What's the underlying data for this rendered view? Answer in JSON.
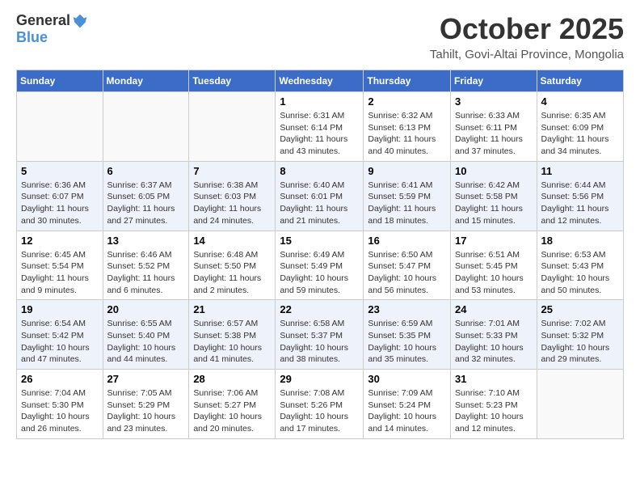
{
  "header": {
    "logo_general": "General",
    "logo_blue": "Blue",
    "month_title": "October 2025",
    "location": "Tahilt, Govi-Altai Province, Mongolia"
  },
  "weekdays": [
    "Sunday",
    "Monday",
    "Tuesday",
    "Wednesday",
    "Thursday",
    "Friday",
    "Saturday"
  ],
  "weeks": [
    [
      {
        "day": "",
        "info": ""
      },
      {
        "day": "",
        "info": ""
      },
      {
        "day": "",
        "info": ""
      },
      {
        "day": "1",
        "info": "Sunrise: 6:31 AM\nSunset: 6:14 PM\nDaylight: 11 hours and 43 minutes."
      },
      {
        "day": "2",
        "info": "Sunrise: 6:32 AM\nSunset: 6:13 PM\nDaylight: 11 hours and 40 minutes."
      },
      {
        "day": "3",
        "info": "Sunrise: 6:33 AM\nSunset: 6:11 PM\nDaylight: 11 hours and 37 minutes."
      },
      {
        "day": "4",
        "info": "Sunrise: 6:35 AM\nSunset: 6:09 PM\nDaylight: 11 hours and 34 minutes."
      }
    ],
    [
      {
        "day": "5",
        "info": "Sunrise: 6:36 AM\nSunset: 6:07 PM\nDaylight: 11 hours and 30 minutes."
      },
      {
        "day": "6",
        "info": "Sunrise: 6:37 AM\nSunset: 6:05 PM\nDaylight: 11 hours and 27 minutes."
      },
      {
        "day": "7",
        "info": "Sunrise: 6:38 AM\nSunset: 6:03 PM\nDaylight: 11 hours and 24 minutes."
      },
      {
        "day": "8",
        "info": "Sunrise: 6:40 AM\nSunset: 6:01 PM\nDaylight: 11 hours and 21 minutes."
      },
      {
        "day": "9",
        "info": "Sunrise: 6:41 AM\nSunset: 5:59 PM\nDaylight: 11 hours and 18 minutes."
      },
      {
        "day": "10",
        "info": "Sunrise: 6:42 AM\nSunset: 5:58 PM\nDaylight: 11 hours and 15 minutes."
      },
      {
        "day": "11",
        "info": "Sunrise: 6:44 AM\nSunset: 5:56 PM\nDaylight: 11 hours and 12 minutes."
      }
    ],
    [
      {
        "day": "12",
        "info": "Sunrise: 6:45 AM\nSunset: 5:54 PM\nDaylight: 11 hours and 9 minutes."
      },
      {
        "day": "13",
        "info": "Sunrise: 6:46 AM\nSunset: 5:52 PM\nDaylight: 11 hours and 6 minutes."
      },
      {
        "day": "14",
        "info": "Sunrise: 6:48 AM\nSunset: 5:50 PM\nDaylight: 11 hours and 2 minutes."
      },
      {
        "day": "15",
        "info": "Sunrise: 6:49 AM\nSunset: 5:49 PM\nDaylight: 10 hours and 59 minutes."
      },
      {
        "day": "16",
        "info": "Sunrise: 6:50 AM\nSunset: 5:47 PM\nDaylight: 10 hours and 56 minutes."
      },
      {
        "day": "17",
        "info": "Sunrise: 6:51 AM\nSunset: 5:45 PM\nDaylight: 10 hours and 53 minutes."
      },
      {
        "day": "18",
        "info": "Sunrise: 6:53 AM\nSunset: 5:43 PM\nDaylight: 10 hours and 50 minutes."
      }
    ],
    [
      {
        "day": "19",
        "info": "Sunrise: 6:54 AM\nSunset: 5:42 PM\nDaylight: 10 hours and 47 minutes."
      },
      {
        "day": "20",
        "info": "Sunrise: 6:55 AM\nSunset: 5:40 PM\nDaylight: 10 hours and 44 minutes."
      },
      {
        "day": "21",
        "info": "Sunrise: 6:57 AM\nSunset: 5:38 PM\nDaylight: 10 hours and 41 minutes."
      },
      {
        "day": "22",
        "info": "Sunrise: 6:58 AM\nSunset: 5:37 PM\nDaylight: 10 hours and 38 minutes."
      },
      {
        "day": "23",
        "info": "Sunrise: 6:59 AM\nSunset: 5:35 PM\nDaylight: 10 hours and 35 minutes."
      },
      {
        "day": "24",
        "info": "Sunrise: 7:01 AM\nSunset: 5:33 PM\nDaylight: 10 hours and 32 minutes."
      },
      {
        "day": "25",
        "info": "Sunrise: 7:02 AM\nSunset: 5:32 PM\nDaylight: 10 hours and 29 minutes."
      }
    ],
    [
      {
        "day": "26",
        "info": "Sunrise: 7:04 AM\nSunset: 5:30 PM\nDaylight: 10 hours and 26 minutes."
      },
      {
        "day": "27",
        "info": "Sunrise: 7:05 AM\nSunset: 5:29 PM\nDaylight: 10 hours and 23 minutes."
      },
      {
        "day": "28",
        "info": "Sunrise: 7:06 AM\nSunset: 5:27 PM\nDaylight: 10 hours and 20 minutes."
      },
      {
        "day": "29",
        "info": "Sunrise: 7:08 AM\nSunset: 5:26 PM\nDaylight: 10 hours and 17 minutes."
      },
      {
        "day": "30",
        "info": "Sunrise: 7:09 AM\nSunset: 5:24 PM\nDaylight: 10 hours and 14 minutes."
      },
      {
        "day": "31",
        "info": "Sunrise: 7:10 AM\nSunset: 5:23 PM\nDaylight: 10 hours and 12 minutes."
      },
      {
        "day": "",
        "info": ""
      }
    ]
  ]
}
